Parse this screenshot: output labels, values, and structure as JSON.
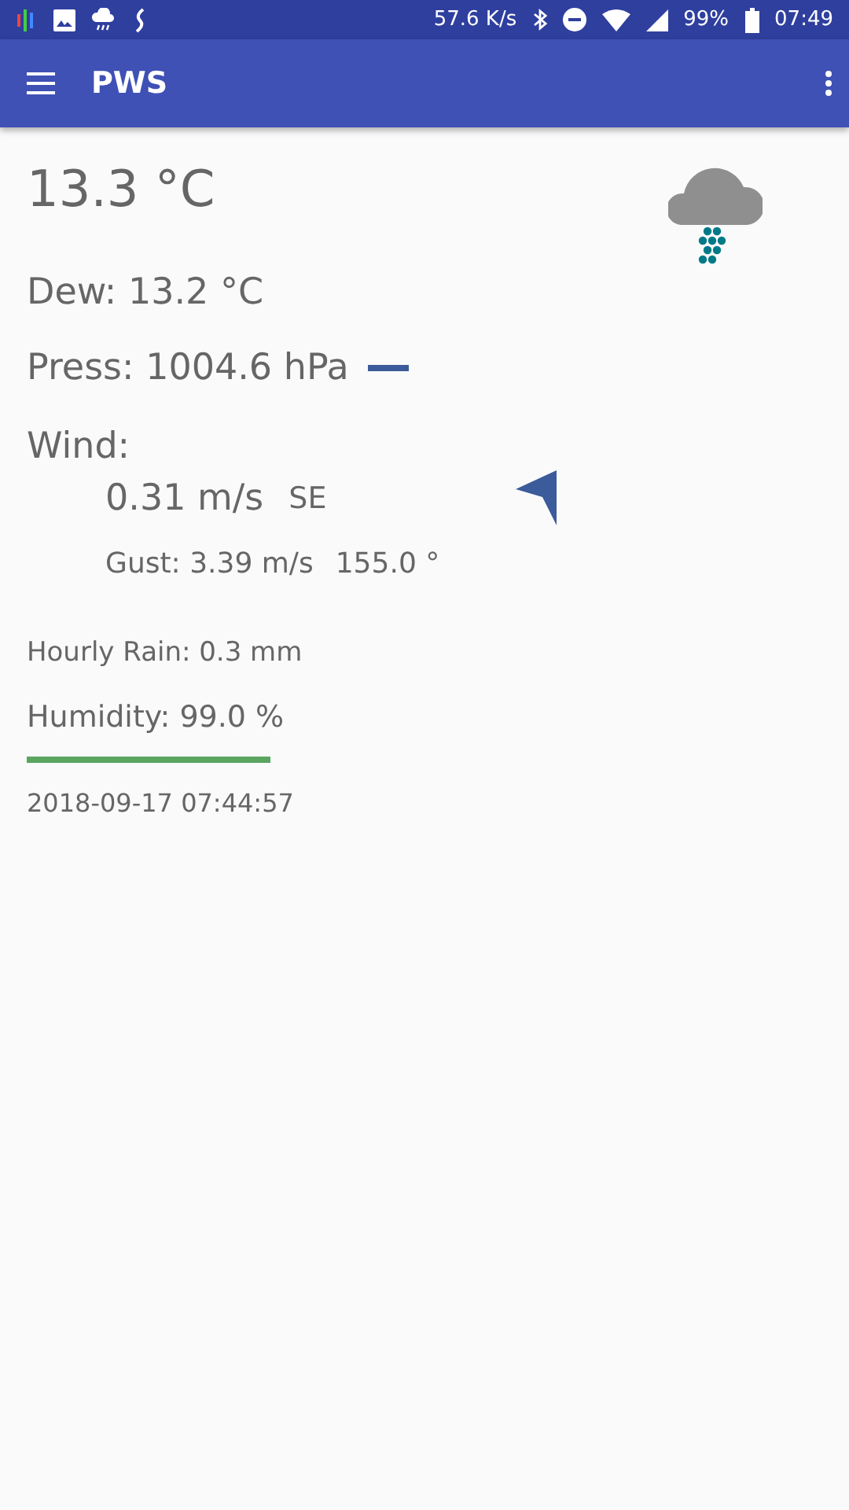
{
  "status_bar": {
    "speed": "57.6 K/s",
    "battery": "99%",
    "time": "07:49"
  },
  "app_bar": {
    "title": "PWS"
  },
  "weather": {
    "temperature": "13.3 °C",
    "dew": "Dew: 13.2 °C",
    "pressure": "Press: 1004.6 hPa",
    "wind_label": "Wind:",
    "wind_speed": "0.31 m/s",
    "wind_direction": "SE",
    "gust": "Gust: 3.39 m/s",
    "wind_degrees": "155.0 °",
    "hourly_rain": "Hourly Rain: 0.3 mm",
    "humidity": "Humidity: 99.0 %",
    "timestamp": "2018-09-17 07:44:57"
  }
}
